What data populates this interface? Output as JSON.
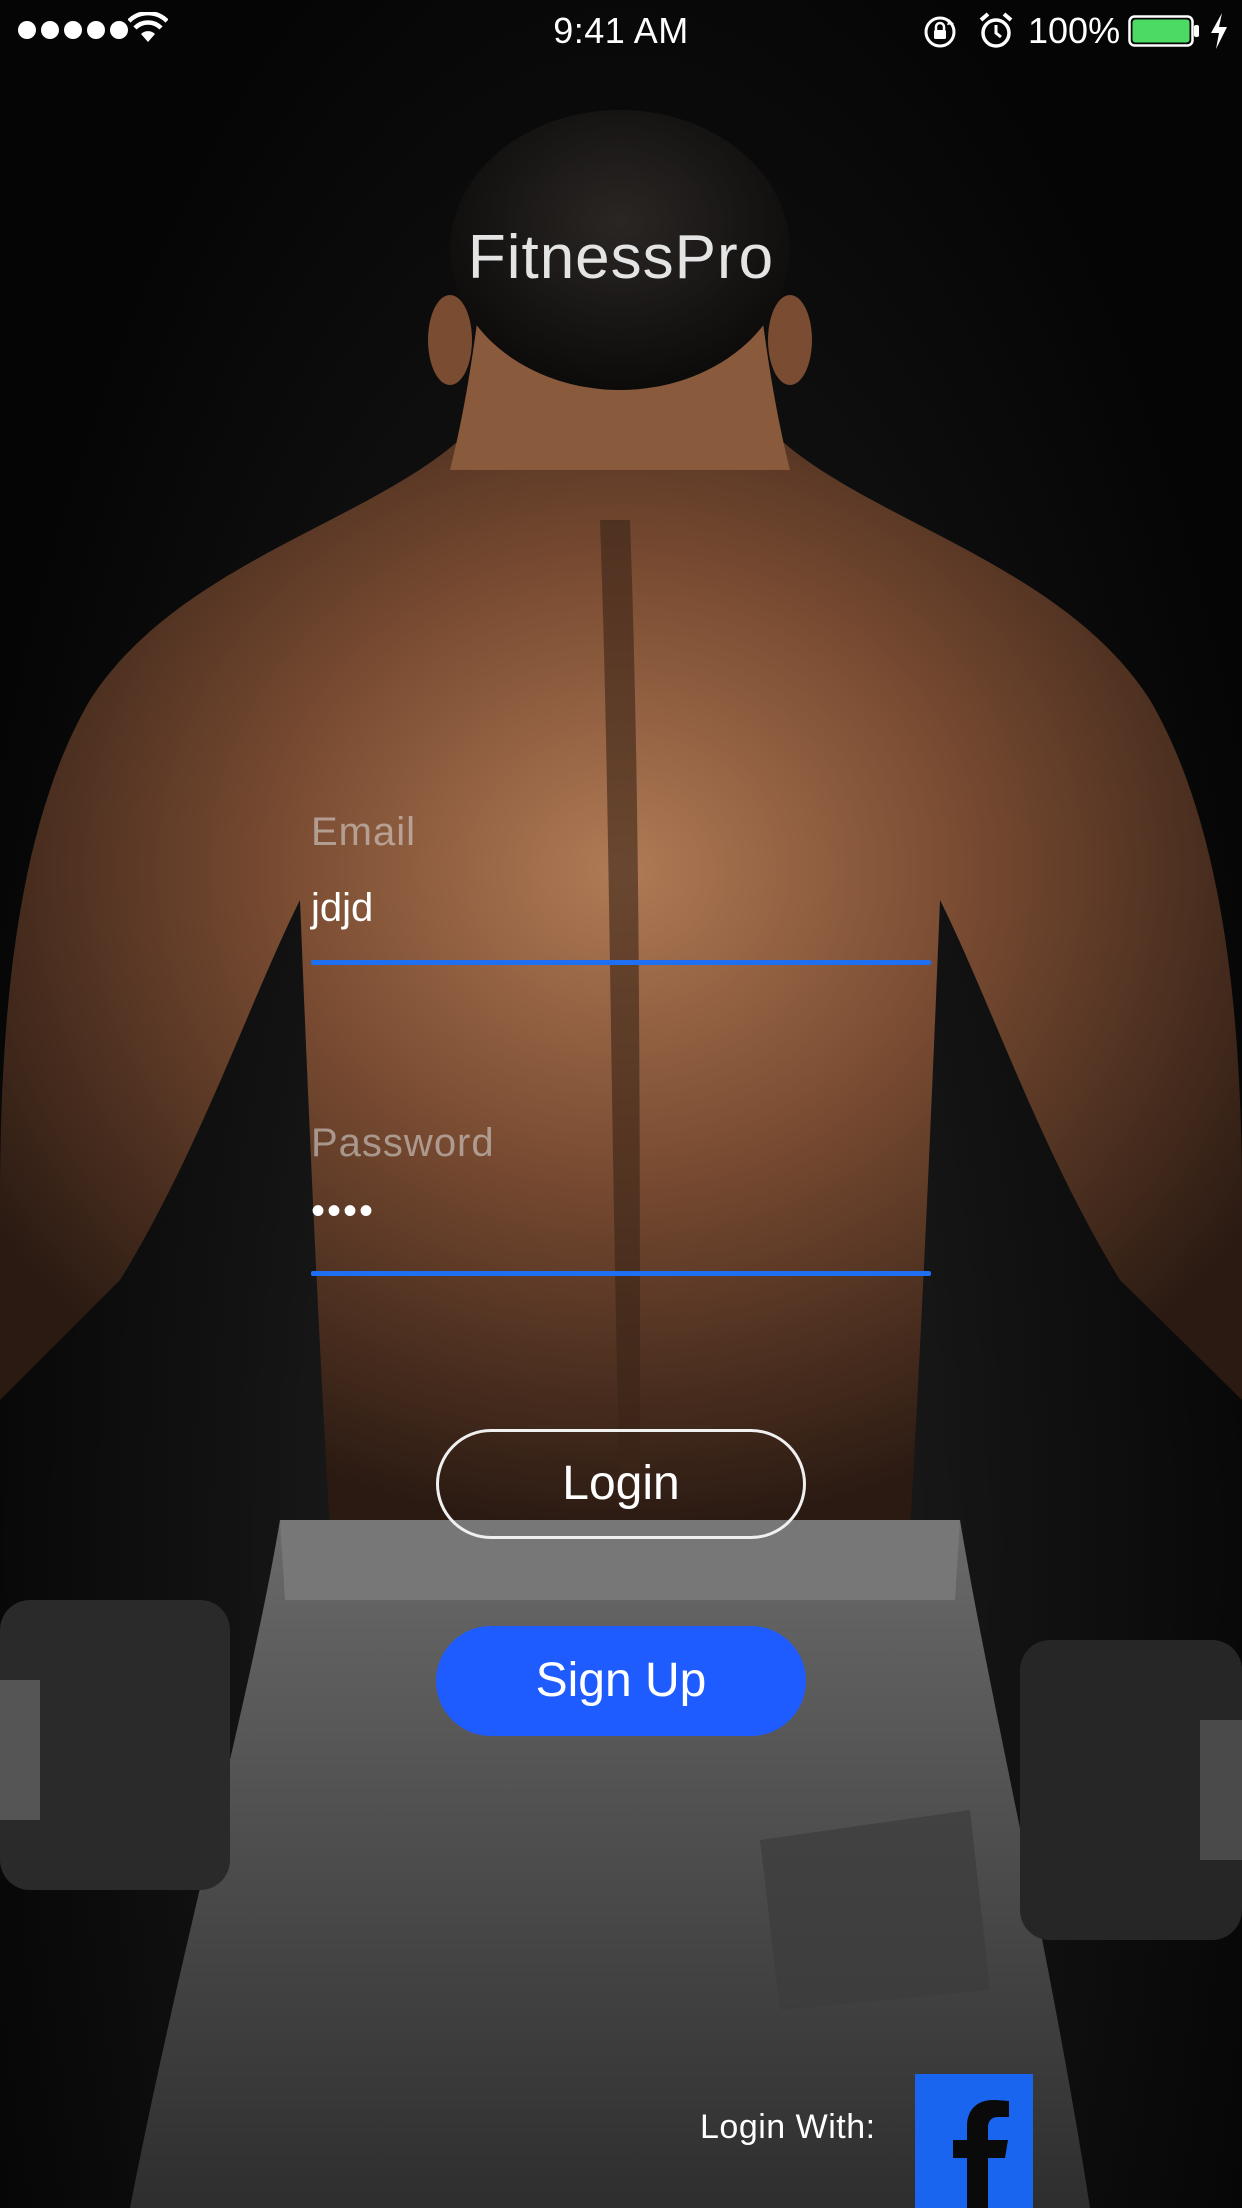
{
  "status_bar": {
    "time": "9:41 AM",
    "battery_percent": "100%",
    "battery_level": 1.0,
    "signal_icon": "signal-dots-icon",
    "wifi_icon": "wifi-icon",
    "rotation_icon": "rotation-lock-icon",
    "alarm_icon": "alarm-icon",
    "charging_icon": "charging-bolt-icon"
  },
  "app": {
    "title": "FitnessPro"
  },
  "form": {
    "email": {
      "label": "Email",
      "value": "jdjd"
    },
    "password": {
      "label": "Password",
      "value": "••••"
    }
  },
  "buttons": {
    "login_label": "Login",
    "signup_label": "Sign Up"
  },
  "social": {
    "label": "Login With:",
    "facebook_icon": "facebook-icon"
  },
  "colors": {
    "accent": "#1f6ff2",
    "signup_bg": "#1f5cff",
    "facebook_bg": "#1a65f0",
    "battery_fill": "#4cd964"
  }
}
